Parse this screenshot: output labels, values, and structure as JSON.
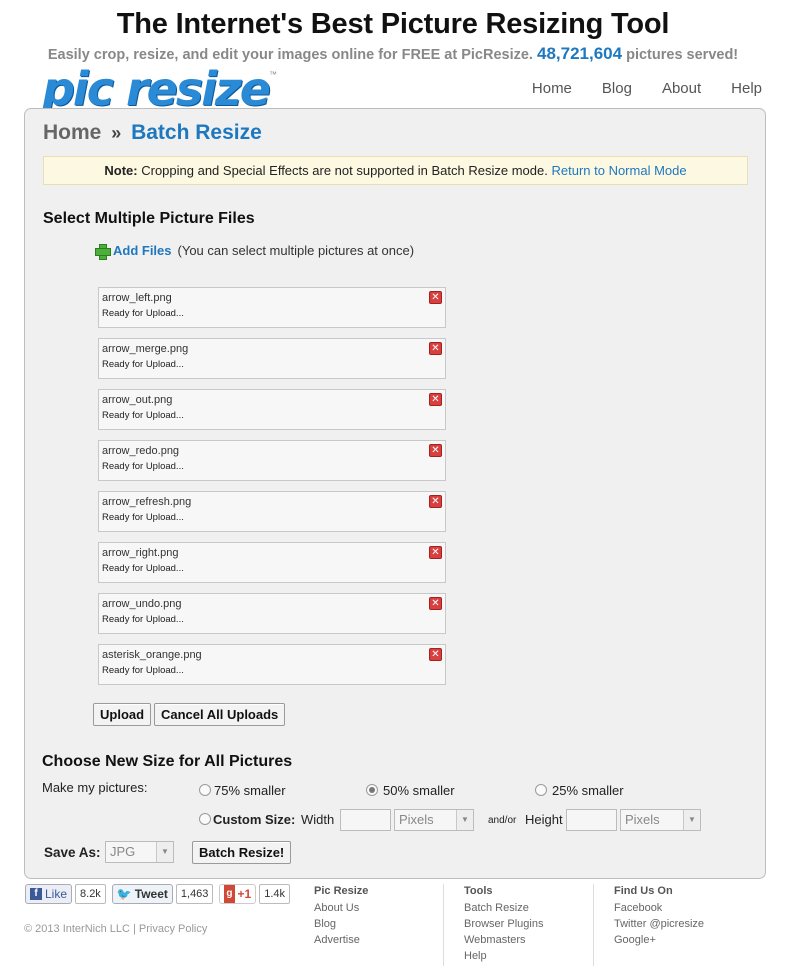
{
  "header": {
    "headline": "The Internet's Best Picture Resizing Tool",
    "tagline_before": "Easily crop, resize, and edit your images online for FREE at PicResize.",
    "pictures_count": "48,721,604",
    "tagline_after": "pictures served!",
    "logo_text": "pic resize",
    "logo_tm": "™",
    "nav": [
      "Home",
      "Blog",
      "About",
      "Help"
    ]
  },
  "breadcrumb": {
    "home": "Home",
    "separator": "»",
    "current": "Batch Resize"
  },
  "note": {
    "label": "Note:",
    "text": "Cropping and Special Effects are not supported in Batch Resize mode.",
    "link": "Return to Normal Mode"
  },
  "files_section": {
    "title": "Select Multiple Picture Files",
    "add_files": "Add Files",
    "add_files_hint": "(You can select multiple pictures at once)",
    "files": [
      {
        "name": "arrow_left.png",
        "status": "Ready for Upload..."
      },
      {
        "name": "arrow_merge.png",
        "status": "Ready for Upload..."
      },
      {
        "name": "arrow_out.png",
        "status": "Ready for Upload..."
      },
      {
        "name": "arrow_redo.png",
        "status": "Ready for Upload..."
      },
      {
        "name": "arrow_refresh.png",
        "status": "Ready for Upload..."
      },
      {
        "name": "arrow_right.png",
        "status": "Ready for Upload..."
      },
      {
        "name": "arrow_undo.png",
        "status": "Ready for Upload..."
      },
      {
        "name": "asterisk_orange.png",
        "status": "Ready for Upload..."
      }
    ],
    "upload_label": "Upload",
    "cancel_label": "Cancel All Uploads"
  },
  "size_section": {
    "title": "Choose New Size for All Pictures",
    "make_label": "Make my pictures:",
    "opt_75": "75% smaller",
    "opt_50": "50% smaller",
    "opt_25": "25% smaller",
    "selected": "50% smaller",
    "custom_label": "Custom Size:",
    "width_label": "Width",
    "width_unit": "Pixels",
    "andor": "and/or",
    "height_label": "Height",
    "height_unit": "Pixels",
    "save_as_label": "Save As:",
    "save_as_value": "JPG",
    "batch_button": "Batch Resize!"
  },
  "footer": {
    "like_label": "Like",
    "like_count": "8.2k",
    "tweet_label": "Tweet",
    "tweet_count": "1,463",
    "gplus_label": "+1",
    "gplus_count": "1.4k",
    "copyright": "© 2013 InterNich LLC | Privacy Policy",
    "col1": {
      "title": "Pic Resize",
      "items": [
        "About Us",
        "Blog",
        "Advertise"
      ]
    },
    "col2": {
      "title": "Tools",
      "items": [
        "Batch Resize",
        "Browser Plugins",
        "Webmasters",
        "Help"
      ]
    },
    "col3": {
      "title": "Find Us On",
      "items": [
        "Facebook",
        "Twitter @picresize",
        "Google+"
      ]
    }
  }
}
